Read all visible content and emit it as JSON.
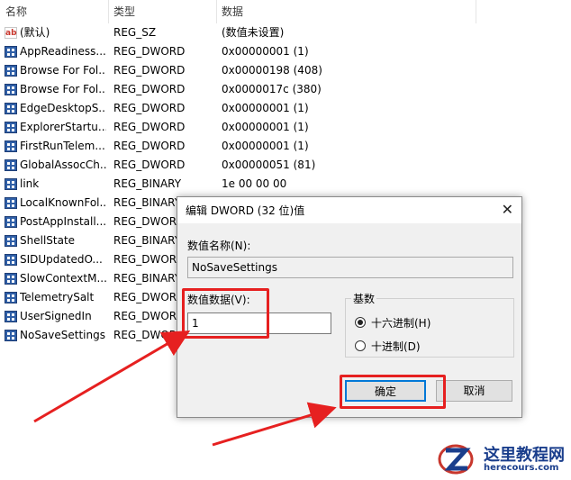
{
  "list": {
    "headers": {
      "name": "名称",
      "type": "类型",
      "data": "数据"
    },
    "rows": [
      {
        "icon": "string-value-icon",
        "name": "(默认)",
        "type": "REG_SZ",
        "data": "(数值未设置)"
      },
      {
        "icon": "binary-value-icon",
        "name": "AppReadiness...",
        "type": "REG_DWORD",
        "data": "0x00000001 (1)"
      },
      {
        "icon": "binary-value-icon",
        "name": "Browse For Fol...",
        "type": "REG_DWORD",
        "data": "0x00000198 (408)"
      },
      {
        "icon": "binary-value-icon",
        "name": "Browse For Fol...",
        "type": "REG_DWORD",
        "data": "0x0000017c (380)"
      },
      {
        "icon": "binary-value-icon",
        "name": "EdgeDesktopS...",
        "type": "REG_DWORD",
        "data": "0x00000001 (1)"
      },
      {
        "icon": "binary-value-icon",
        "name": "ExplorerStartu...",
        "type": "REG_DWORD",
        "data": "0x00000001 (1)"
      },
      {
        "icon": "binary-value-icon",
        "name": "FirstRunTelem...",
        "type": "REG_DWORD",
        "data": "0x00000001 (1)"
      },
      {
        "icon": "binary-value-icon",
        "name": "GlobalAssocCh...",
        "type": "REG_DWORD",
        "data": "0x00000051 (81)"
      },
      {
        "icon": "binary-value-icon",
        "name": "link",
        "type": "REG_BINARY",
        "data": "1e 00 00 00"
      },
      {
        "icon": "binary-value-icon",
        "name": "LocalKnownFol...",
        "type": "REG_BINARY",
        "data": ""
      },
      {
        "icon": "binary-value-icon",
        "name": "PostAppInstall...",
        "type": "REG_DWORD",
        "data": ""
      },
      {
        "icon": "binary-value-icon",
        "name": "ShellState",
        "type": "REG_BINARY",
        "data": ""
      },
      {
        "icon": "binary-value-icon",
        "name": "SIDUpdatedO...",
        "type": "REG_DWORD",
        "data": ""
      },
      {
        "icon": "binary-value-icon",
        "name": "SlowContextM...",
        "type": "REG_BINARY",
        "data": ""
      },
      {
        "icon": "binary-value-icon",
        "name": "TelemetrySalt",
        "type": "REG_DWORD",
        "data": ""
      },
      {
        "icon": "binary-value-icon",
        "name": "UserSignedIn",
        "type": "REG_DWORD",
        "data": ""
      },
      {
        "icon": "binary-value-icon",
        "name": "NoSaveSettings",
        "type": "REG_DWORD",
        "data": ""
      }
    ]
  },
  "dialog": {
    "title": "编辑 DWORD (32 位)值",
    "close_glyph": "✕",
    "value_name_label": "数值名称(N):",
    "value_name": "NoSaveSettings",
    "value_data_label": "数值数据(V):",
    "value_data": "1",
    "base_label": "基数",
    "radio_hex": "十六进制(H)",
    "radio_dec": "十进制(D)",
    "selected_base": "hex",
    "ok": "确定",
    "cancel": "取消"
  },
  "watermark": {
    "site_name": "这里教程网",
    "site_url": "herecours.com"
  },
  "colors": {
    "annotation_red": "#e62020",
    "focus_blue": "#0078d7"
  }
}
